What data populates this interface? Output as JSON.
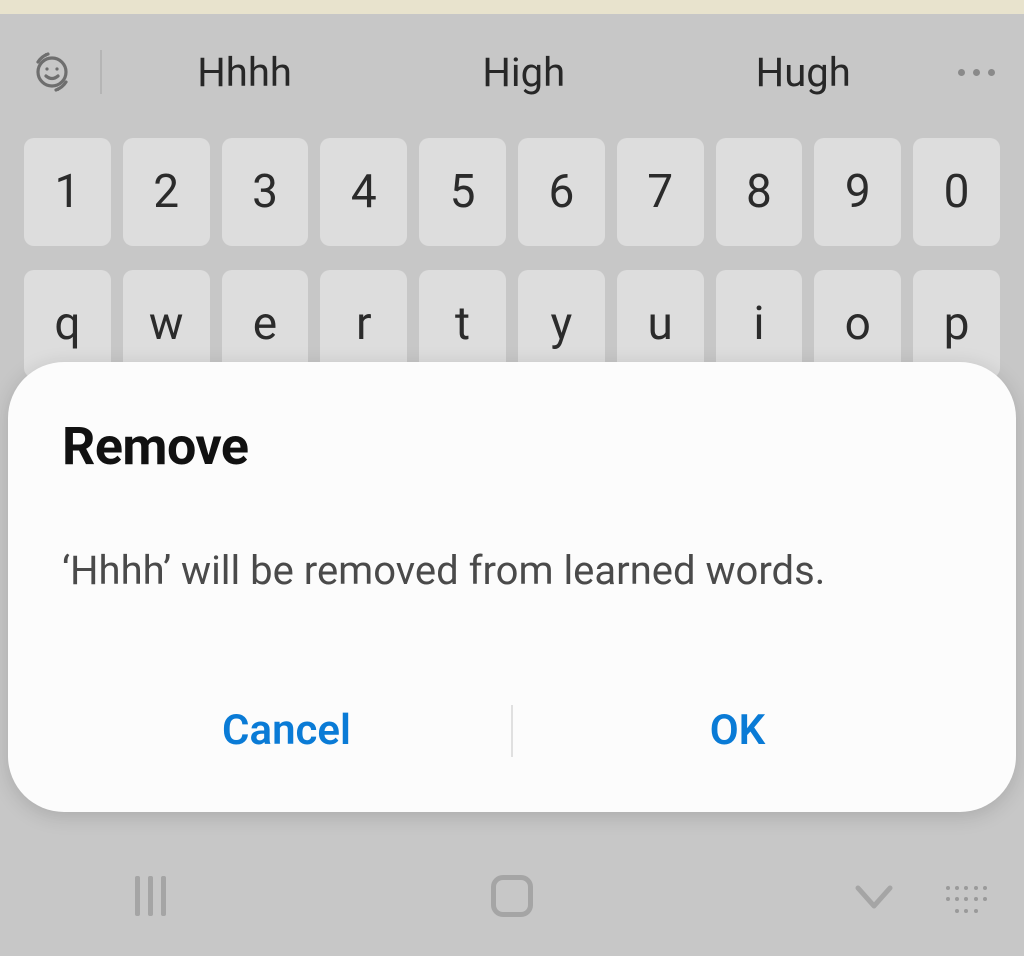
{
  "suggestions": {
    "items": [
      "Hhhh",
      "High",
      "Hugh"
    ]
  },
  "keyboard": {
    "row1": [
      "1",
      "2",
      "3",
      "4",
      "5",
      "6",
      "7",
      "8",
      "9",
      "0"
    ],
    "row2": [
      "q",
      "w",
      "e",
      "r",
      "t",
      "y",
      "u",
      "i",
      "o",
      "p"
    ]
  },
  "dialog": {
    "title": "Remove",
    "message": "‘Hhhh’ will be removed from learned words.",
    "cancel_label": "Cancel",
    "ok_label": "OK"
  }
}
